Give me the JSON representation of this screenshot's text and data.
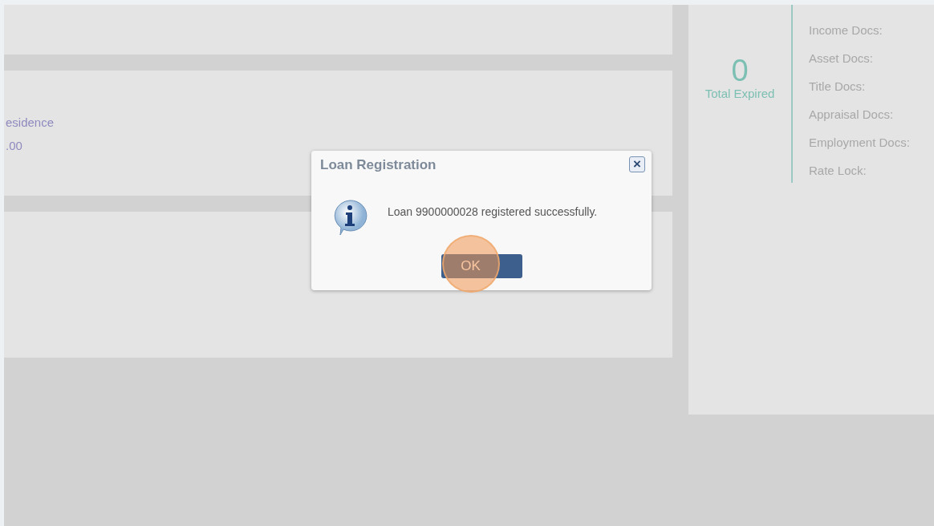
{
  "detail_lines": [
    "esidence",
    ".00"
  ],
  "summary": {
    "count": "0",
    "count_label": "Total Expired",
    "items": [
      "Income Docs:",
      "Asset Docs:",
      "Title Docs:",
      "Appraisal Docs:",
      "Employment Docs:",
      "Rate Lock:"
    ]
  },
  "dialog": {
    "title": "Loan Registration",
    "message": "Loan 9900000028 registered successfully.",
    "button": "OK",
    "close": "×"
  }
}
